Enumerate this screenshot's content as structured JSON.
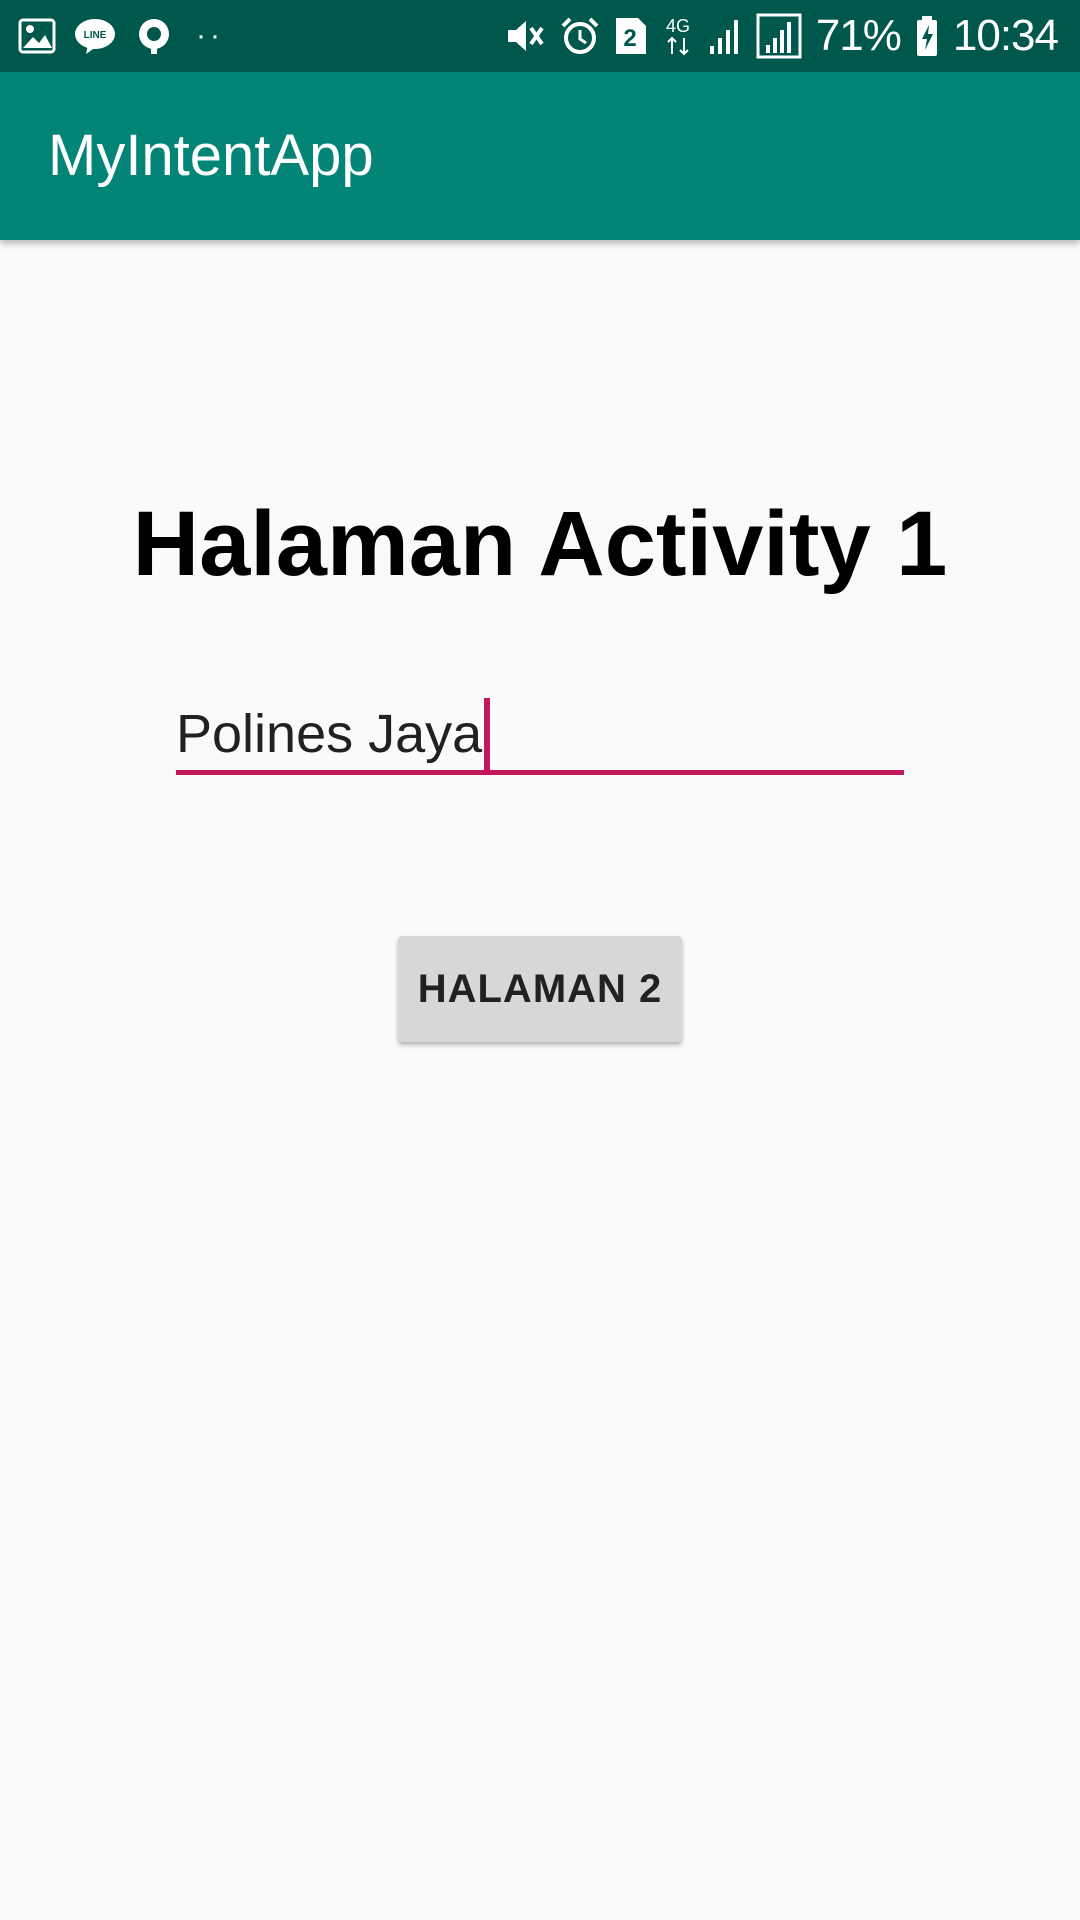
{
  "status_bar": {
    "left_icons": [
      "gallery-icon",
      "line-app-icon",
      "location-icon"
    ],
    "overflow_dots": "··",
    "right_icons": [
      "vibrate-mute-icon",
      "alarm-icon",
      "sim-2-icon",
      "network-4g-icon",
      "signal-icon",
      "signal-full-icon"
    ],
    "sim_number": "2",
    "network_type": "4G",
    "battery_percent": "71%",
    "time": "10:34",
    "background_color": "#00584c"
  },
  "app_bar": {
    "title": "MyIntentApp",
    "background_color": "#028576"
  },
  "main": {
    "heading": "Halaman Activity 1",
    "input": {
      "value": "Polines Jaya",
      "accent_color": "#c2185b"
    },
    "button": {
      "label": "HALAMAN 2"
    }
  }
}
